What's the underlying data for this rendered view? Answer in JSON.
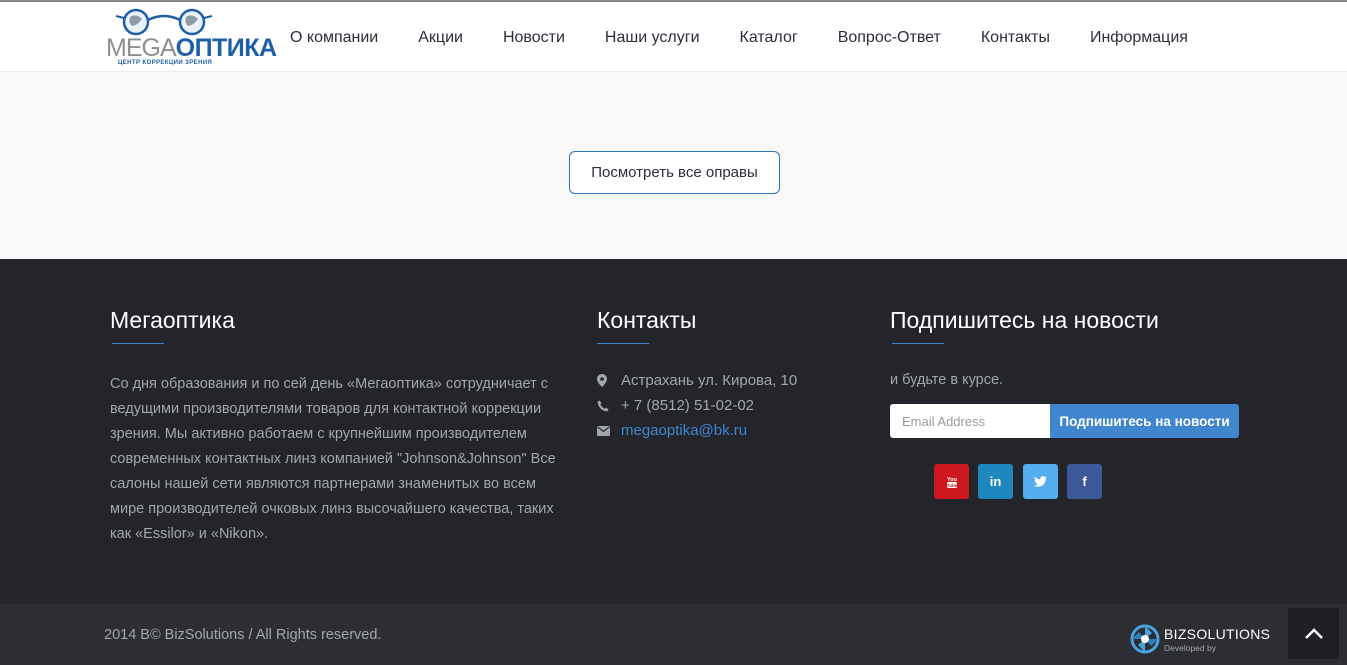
{
  "header": {
    "logo": {
      "brand_mega": "MEGA",
      "brand_optika": "ОПТИКА",
      "tagline": "ЦЕНТР КОРРЕКЦИИ ЗРЕНИЯ"
    },
    "nav": [
      {
        "label": "О компании"
      },
      {
        "label": "Акции"
      },
      {
        "label": "Новости"
      },
      {
        "label": "Наши услуги"
      },
      {
        "label": "Каталог"
      },
      {
        "label": "Вопрос-Ответ"
      },
      {
        "label": "Контакты"
      },
      {
        "label": "Информация"
      }
    ]
  },
  "main": {
    "view_all_label": "Посмотреть все оправы"
  },
  "footer": {
    "about": {
      "title": "Мегаоптика",
      "text": "Со дня образования и по сей день «Мегаоптика» сотрудничает с ведущими производителями товаров для контактной коррекции зрения. Мы активно работаем с крупнейшим производителем современных контактных линз компанией \"Johnson&Johnson\" Все салоны нашей сети являются партнерами знаменитых во всем мире производителей очковых линз высочайшего качества, таких как «Essilor» и «Nikon»."
    },
    "contacts": {
      "title": "Контакты",
      "address": "Астрахань ул. Кирова, 10",
      "phone": "+ 7 (8512) 51-02-02",
      "email": "megaoptika@bk.ru"
    },
    "subscribe": {
      "title": "Подпишитесь на новости",
      "subtitle": "и будьте в курсе.",
      "email_placeholder": "Email Address",
      "button_label": "Подпишитесь на новости",
      "social": [
        {
          "name": "youtube",
          "glyph": "You",
          "color": "#cc181e"
        },
        {
          "name": "linkedin",
          "glyph": "in",
          "color": "#1d87be"
        },
        {
          "name": "twitter",
          "glyph": "t",
          "color": "#55acee"
        },
        {
          "name": "facebook",
          "glyph": "f",
          "color": "#3b5998"
        }
      ]
    }
  },
  "bottom": {
    "copyright": "2014 B© BizSolutions / All Rights reserved.",
    "developer_name": "BIZSOLUTIONS",
    "developer_caption": "Developed by"
  },
  "colors": {
    "accent": "#3f86cf",
    "footer_bg": "#23252b",
    "bottom_bg": "#2c2e34",
    "youtube": "#cc181e",
    "linkedin": "#1d87be",
    "twitter": "#55acee",
    "facebook": "#3b5998"
  }
}
